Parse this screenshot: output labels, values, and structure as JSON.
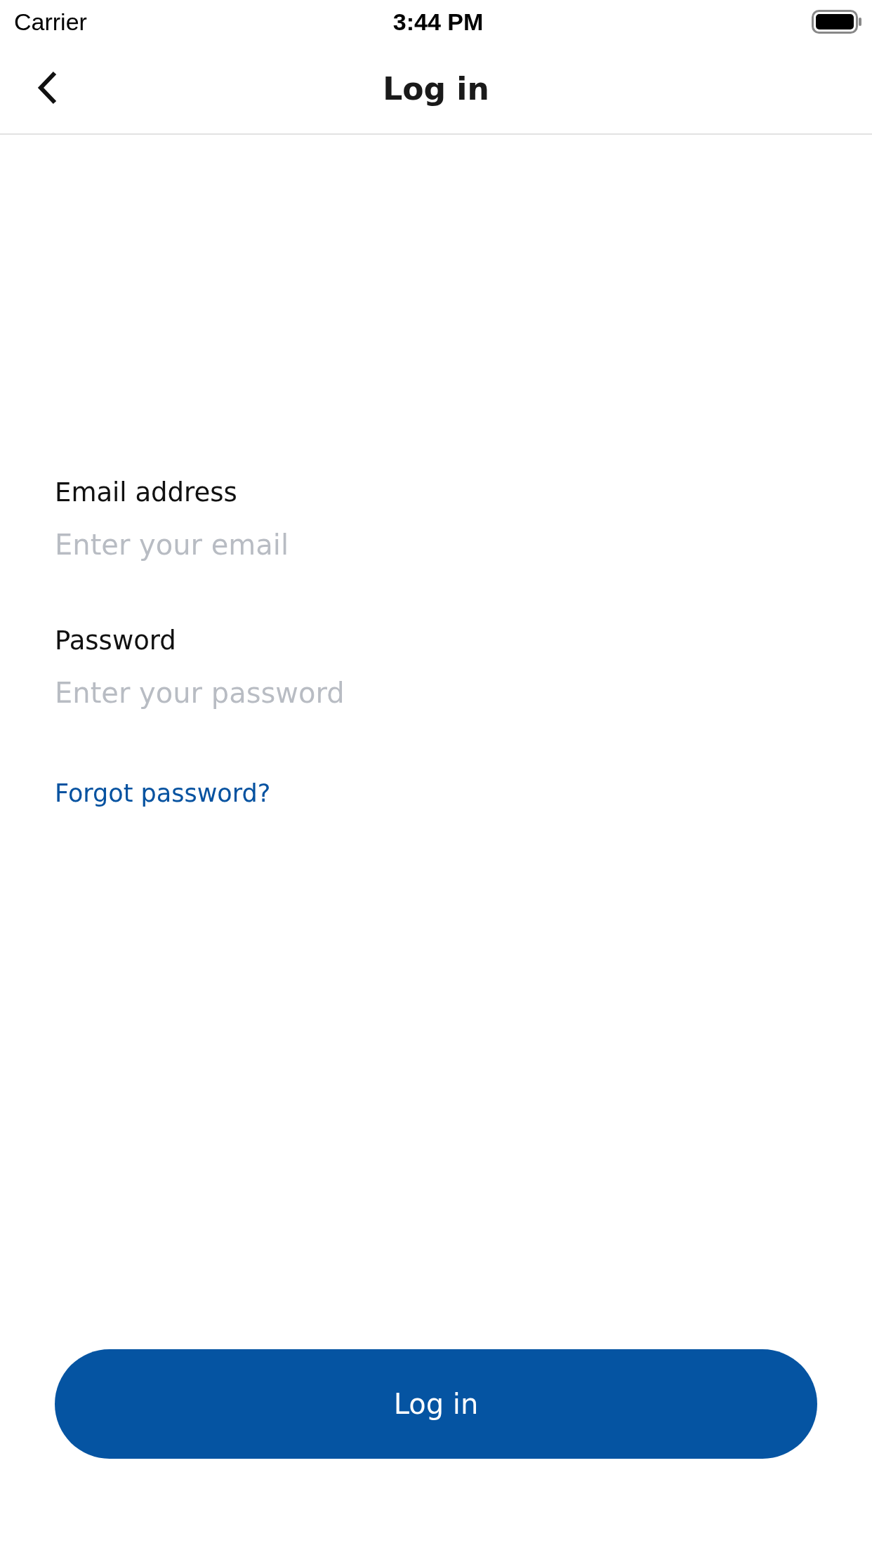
{
  "status_bar": {
    "carrier": "Carrier",
    "time": "3:44 PM"
  },
  "nav": {
    "title": "Log in"
  },
  "fields": [
    {
      "label": "Email address",
      "placeholder": "Enter your email"
    },
    {
      "label": "Password",
      "placeholder": "Enter your password"
    }
  ],
  "forgot_link": "Forgot password?",
  "submit": "Log in"
}
